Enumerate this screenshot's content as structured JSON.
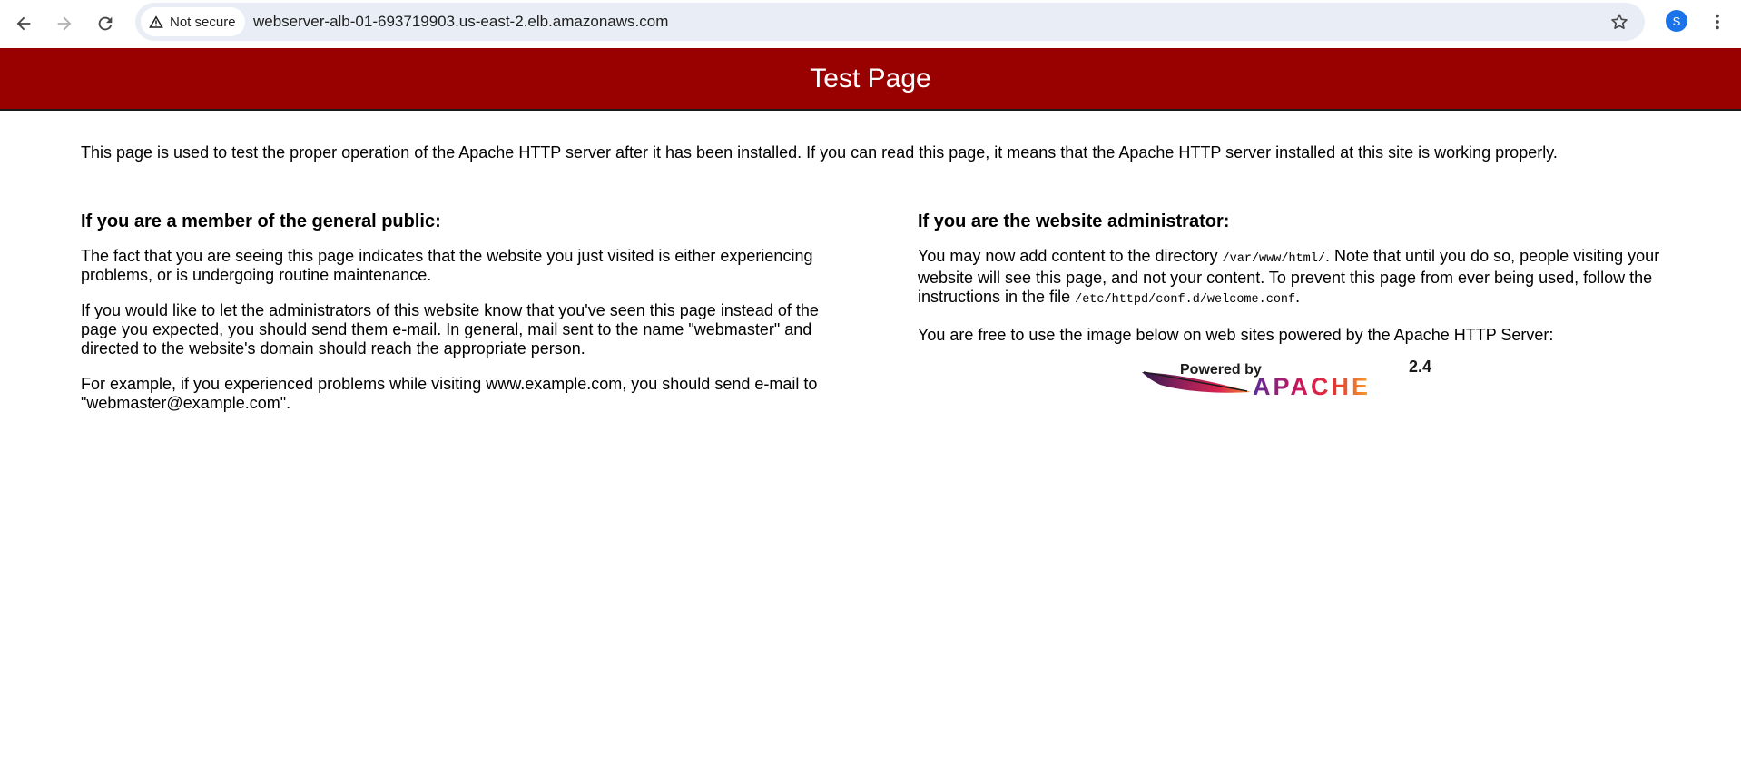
{
  "browser": {
    "security_label": "Not secure",
    "url": "webserver-alb-01-693719903.us-east-2.elb.amazonaws.com",
    "avatar_letter": "S",
    "icons": [
      "back-arrow-icon",
      "forward-arrow-icon",
      "reload-icon",
      "warning-icon",
      "star-icon",
      "kebab-menu-icon"
    ]
  },
  "page": {
    "title": "Test Page",
    "title_bar_color": "#990000",
    "intro": "This page is used to test the proper operation of the Apache HTTP server after it has been installed. If you can read this page, it means that the Apache HTTP server installed at this site is working properly.",
    "public": {
      "heading": "If you are a member of the general public:",
      "p1": "The fact that you are seeing this page indicates that the website you just visited is either experiencing problems, or is undergoing routine maintenance.",
      "p2": "If you would like to let the administrators of this website know that you've seen this page instead of the page you expected, you should send them e-mail. In general, mail sent to the name \"webmaster\" and directed to the website's domain should reach the appropriate person.",
      "p3": "For example, if you experienced problems while visiting www.example.com, you should send e-mail to \"webmaster@example.com\"."
    },
    "admin": {
      "heading": "If you are the website administrator:",
      "p1_a": "You may now add content to the directory ",
      "p1_dir": "/var/www/html/",
      "p1_b": ". Note that until you do so, people visiting your website will see this page, and not your content. To prevent this page from ever being used, follow the instructions in the file ",
      "p1_file": "/etc/httpd/conf.d/welcome.conf",
      "p1_c": ".",
      "p2": "You are free to use the image below on web sites powered by the Apache HTTP Server:"
    },
    "badge": {
      "powered_by": "Powered by",
      "brand": "APACHE",
      "version": "2.4"
    }
  }
}
